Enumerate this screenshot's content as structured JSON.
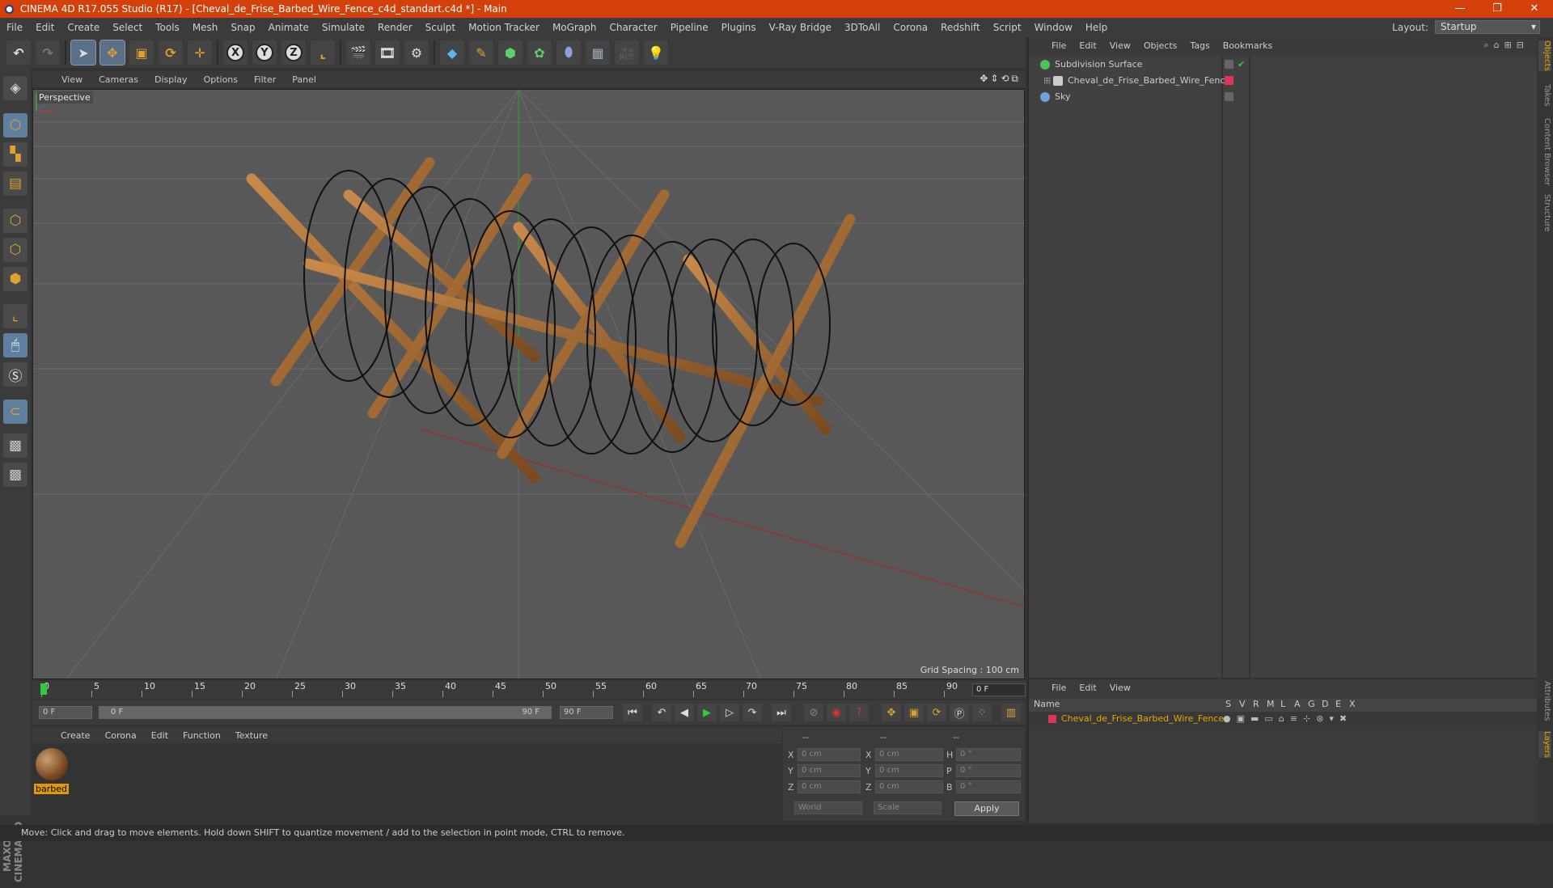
{
  "window": {
    "title": "CINEMA 4D R17.055 Studio (R17) - [Cheval_de_Frise_Barbed_Wire_Fence_c4d_standart.c4d *] - Main",
    "controls": [
      "—",
      "❐",
      "✕"
    ]
  },
  "menubar": [
    "File",
    "Edit",
    "Create",
    "Select",
    "Tools",
    "Mesh",
    "Snap",
    "Animate",
    "Simulate",
    "Render",
    "Sculpt",
    "Motion Tracker",
    "MoGraph",
    "Character",
    "Pipeline",
    "Plugins",
    "V-Ray Bridge",
    "3DToAll",
    "Corona",
    "Redshift",
    "Script",
    "Window",
    "Help"
  ],
  "layout": {
    "label": "Layout:",
    "value": "Startup"
  },
  "toolbar": {
    "axis_x": "X",
    "axis_y": "Y",
    "axis_z": "Z"
  },
  "viewport": {
    "menu": [
      "View",
      "Cameras",
      "Display",
      "Options",
      "Filter",
      "Panel"
    ],
    "label": "Perspective",
    "grid_spacing": "Grid Spacing : 100 cm",
    "nav_icons": "✥⇕⟲⧉"
  },
  "timeline": {
    "ticks": [
      "0",
      "5",
      "10",
      "15",
      "20",
      "25",
      "30",
      "35",
      "40",
      "45",
      "50",
      "55",
      "60",
      "65",
      "70",
      "75",
      "80",
      "85",
      "90"
    ],
    "current_frame": "0 F"
  },
  "transport": {
    "start": "0 F",
    "range_start": "0 F",
    "range_end": "90 F",
    "end": "90 F"
  },
  "material_menu": [
    "Create",
    "Corona",
    "Edit",
    "Function",
    "Texture"
  ],
  "material": {
    "name": "barbed"
  },
  "coords": {
    "headers": [
      "--",
      "--",
      "--"
    ],
    "rows": [
      {
        "a": "X",
        "av": "0 cm",
        "b": "X",
        "bv": "0 cm",
        "c": "H",
        "cv": "0 °"
      },
      {
        "a": "Y",
        "av": "0 cm",
        "b": "Y",
        "bv": "0 cm",
        "c": "P",
        "cv": "0 °"
      },
      {
        "a": "Z",
        "av": "0 cm",
        "b": "Z",
        "bv": "0 cm",
        "c": "B",
        "cv": "0 °"
      }
    ],
    "mode1": "World",
    "mode2": "Scale",
    "apply": "Apply"
  },
  "status": "Move: Click and drag to move elements. Hold down SHIFT to quantize movement / add to the selection in point mode, CTRL to remove.",
  "object_manager": {
    "menu": [
      "File",
      "Edit",
      "View",
      "Objects",
      "Tags",
      "Bookmarks"
    ],
    "objects": [
      {
        "name": "Subdivision Surface",
        "color": "#4fc35a"
      },
      {
        "name": "Cheval_de_Frise_Barbed_Wire_Fence",
        "color": "#cccccc"
      },
      {
        "name": "Sky",
        "color": "#6fa0d8"
      }
    ]
  },
  "layer_manager": {
    "menu": [
      "File",
      "Edit",
      "View"
    ],
    "columns": [
      "Name",
      "S",
      "V",
      "R",
      "M",
      "L",
      "A",
      "G",
      "D",
      "E",
      "X"
    ],
    "layer": {
      "name": "Cheval_de_Frise_Barbed_Wire_Fence",
      "color": "#d9365a"
    }
  },
  "side_tabs": [
    "Objects",
    "Takes",
    "Content Browser",
    "Structure"
  ],
  "side_tabs_bottom": [
    "Attributes",
    "Layers"
  ],
  "brand": "MAXON CINEMA 4D"
}
